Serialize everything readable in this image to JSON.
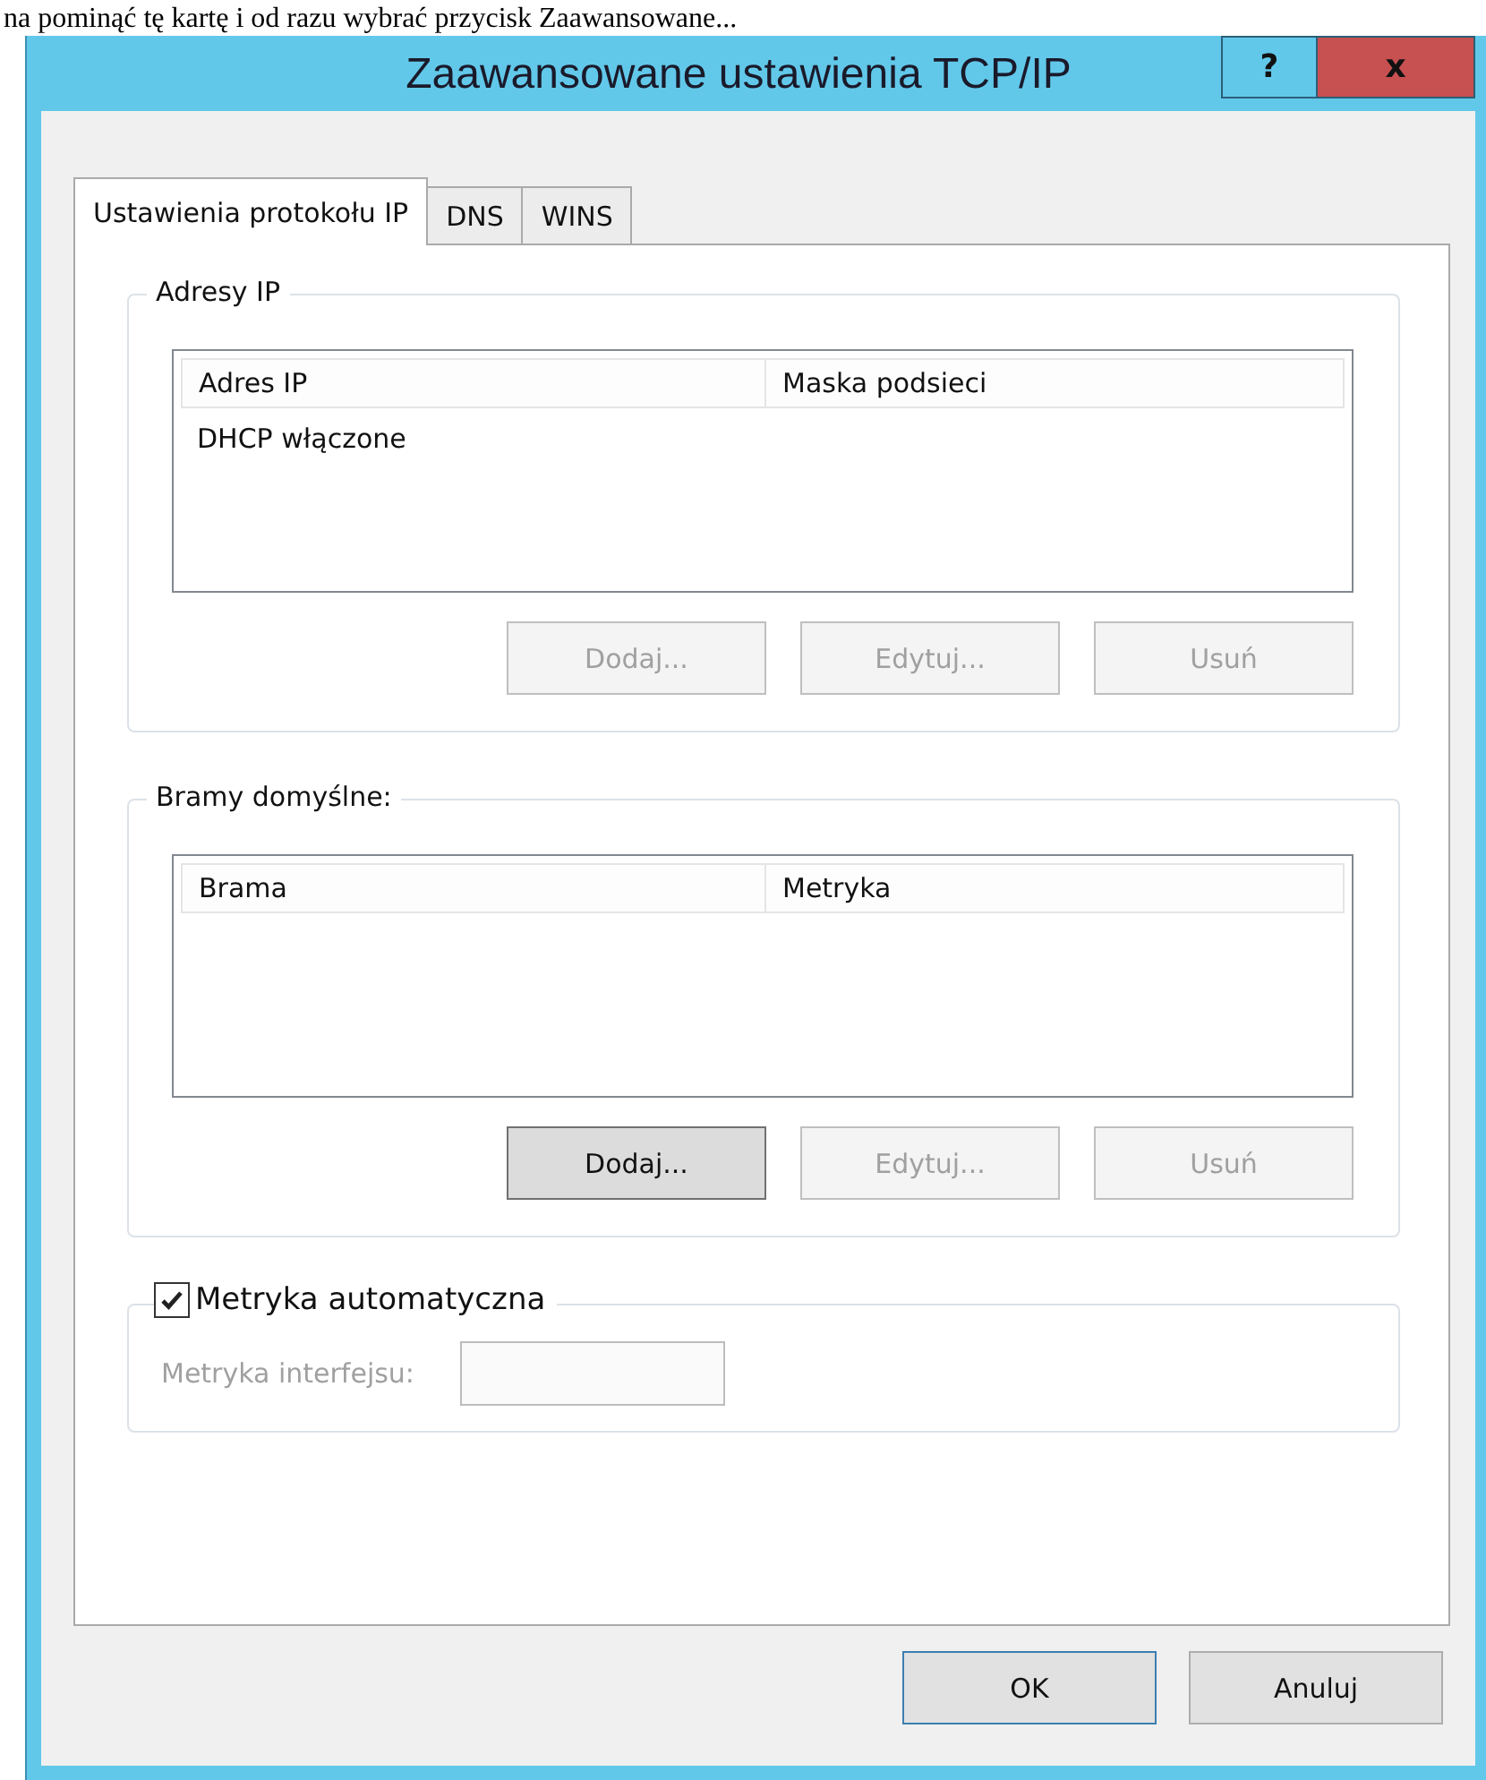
{
  "page_text": "na pominąć tę kartę i od razu wybrać przycisk Zaawansowane...",
  "window": {
    "title": "Zaawansowane ustawienia TCP/IP",
    "help_button": "?",
    "close_button": "x"
  },
  "tabs": [
    {
      "label": "Ustawienia protokołu IP",
      "selected": true
    },
    {
      "label": "DNS",
      "selected": false
    },
    {
      "label": "WINS",
      "selected": false
    }
  ],
  "groups": [
    {
      "title": "Adresy IP",
      "columns": [
        "Adres IP",
        "Maska podsieci"
      ],
      "rows": [
        [
          "DHCP włączone"
        ]
      ],
      "buttons": [
        {
          "label": "Dodaj...",
          "disabled": true,
          "highlighted": false
        },
        {
          "label": "Edytuj...",
          "disabled": true,
          "highlighted": false
        },
        {
          "label": "Usuń",
          "disabled": true,
          "highlighted": false
        }
      ]
    },
    {
      "title": "Bramy domyślne:",
      "columns": [
        "Brama",
        "Metryka"
      ],
      "buttons": [
        {
          "label": "Dodaj...",
          "disabled": false,
          "highlighted": true
        },
        {
          "label": "Edytuj...",
          "disabled": true,
          "highlighted": false
        },
        {
          "label": "Usuń",
          "disabled": true,
          "highlighted": false
        }
      ]
    }
  ],
  "metric": {
    "checkbox": {
      "label": "Metryka automatyczna",
      "checked": true
    },
    "field_label": "Metryka interfejsu:",
    "field_disabled": true
  },
  "footer_buttons": [
    {
      "label": "OK",
      "default": true
    },
    {
      "label": "Anuluj",
      "default": false
    }
  ]
}
